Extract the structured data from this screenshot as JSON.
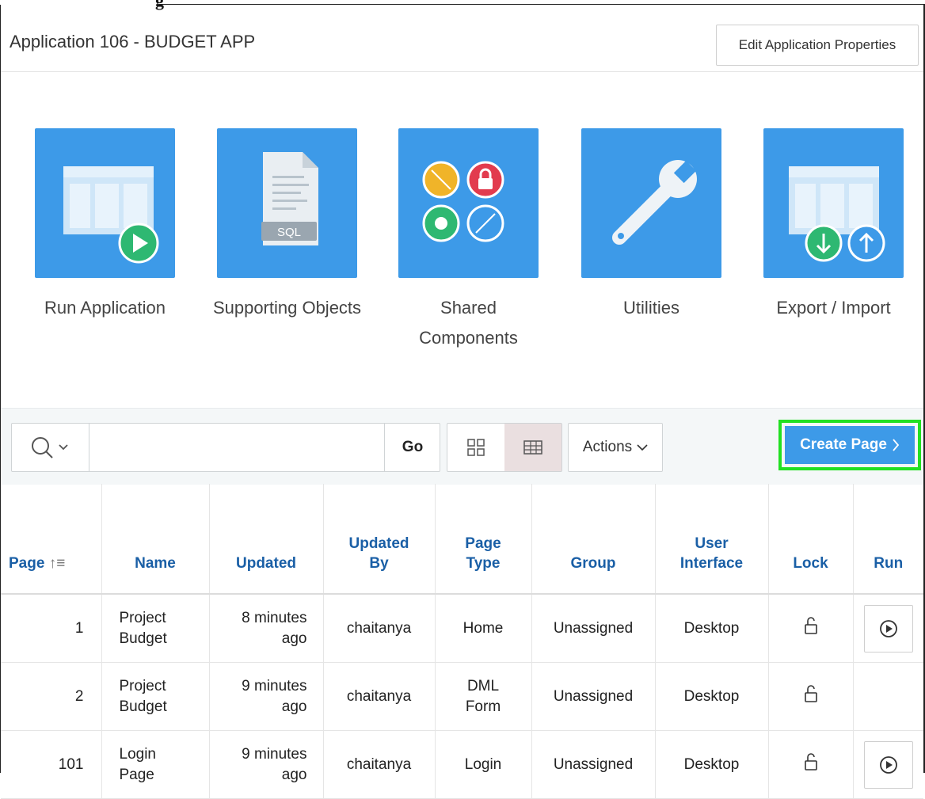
{
  "header": {
    "title": "Application 106 - BUDGET APP",
    "edit_button": "Edit Application Properties"
  },
  "tiles": [
    {
      "label_line1": "Run Application",
      "label_line2": "",
      "icon": "run-application-icon"
    },
    {
      "label_line1": "Supporting Objects",
      "label_line2": "",
      "icon": "sql-file-icon",
      "icon_text": "SQL"
    },
    {
      "label_line1": "Shared",
      "label_line2": "Components",
      "icon": "shared-components-icon"
    },
    {
      "label_line1": "Utilities",
      "label_line2": "",
      "icon": "wrench-icon"
    },
    {
      "label_line1": "Export / Import",
      "label_line2": "",
      "icon": "export-import-icon"
    }
  ],
  "toolbar": {
    "search_value": "",
    "go_label": "Go",
    "actions_label": "Actions",
    "create_page_label": "Create Page",
    "active_view": "report"
  },
  "table": {
    "columns": [
      {
        "line1": "Page",
        "line2": ""
      },
      {
        "line1": "Name",
        "line2": ""
      },
      {
        "line1": "Updated",
        "line2": ""
      },
      {
        "line1": "Updated",
        "line2": "By"
      },
      {
        "line1": "Page",
        "line2": "Type"
      },
      {
        "line1": "Group",
        "line2": ""
      },
      {
        "line1": "User",
        "line2": "Interface"
      },
      {
        "line1": "Lock",
        "line2": ""
      },
      {
        "line1": "Run",
        "line2": ""
      }
    ],
    "rows": [
      {
        "page": "1",
        "name1": "Project",
        "name2": "Budget",
        "updated1": "8 minutes",
        "updated2": "ago",
        "updated_by": "chaitanya",
        "type1": "Home",
        "type2": "",
        "group": "Unassigned",
        "ui": "Desktop",
        "run": true
      },
      {
        "page": "2",
        "name1": "Project",
        "name2": "Budget",
        "updated1": "9 minutes",
        "updated2": "ago",
        "updated_by": "chaitanya",
        "type1": "DML",
        "type2": "Form",
        "group": "Unassigned",
        "ui": "Desktop",
        "run": false
      },
      {
        "page": "101",
        "name1": "Login",
        "name2": "Page",
        "updated1": "9 minutes",
        "updated2": "ago",
        "updated_by": "chaitanya",
        "type1": "Login",
        "type2": "",
        "group": "Unassigned",
        "ui": "Desktop",
        "run": true
      }
    ]
  },
  "colors": {
    "accent": "#3d9ae8",
    "link": "#1a5fa6",
    "highlight": "#22e022"
  }
}
